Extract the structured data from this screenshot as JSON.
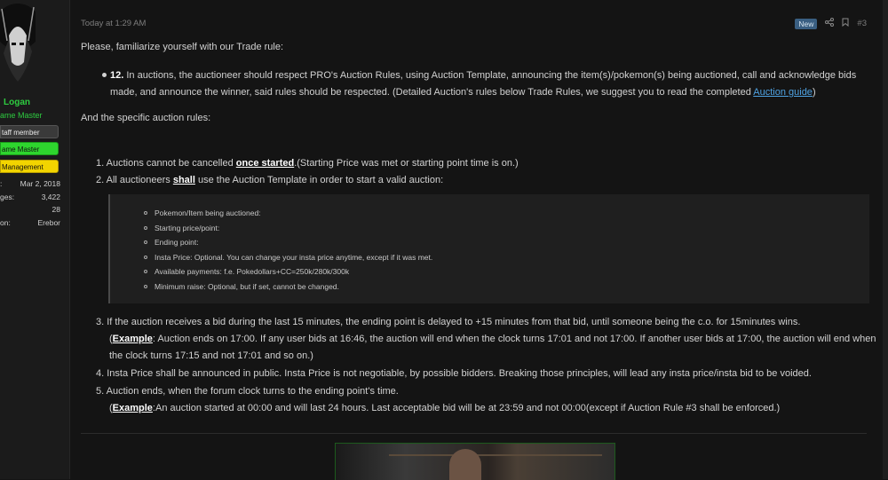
{
  "user": {
    "name": "Logan",
    "title": "ame Master",
    "banners": [
      "taff member",
      "ame Master",
      "Management"
    ],
    "stats": [
      {
        "key": ":",
        "value": "Mar 2, 2018"
      },
      {
        "key": "ges:",
        "value": "3,422"
      },
      {
        "key": "",
        "value": "28"
      },
      {
        "key": "on:",
        "value": "Erebor"
      }
    ]
  },
  "post": {
    "date": "Today at 1:29 AM",
    "badge": "New",
    "number": "#3",
    "intro": "Please, familiarize yourself with our Trade rule:",
    "rule_num": "12.",
    "rule_text": " In auctions, the auctioneer should respect PRO's Auction Rules, using Auction Template, announcing the item(s)/pokemon(s) being auctioned, call and acknowledge bids made, and announce the winner, said rules should be respected. (Detailed Auction's rules below Trade Rules, we suggest you to read the completed ",
    "rule_link": "Auction guide",
    "rule_end": ")",
    "specific": "And the specific auction rules:",
    "r1_a": "1. Auctions cannot be cancelled ",
    "r1_b": "once started",
    "r1_c": ".(Starting Price was met or starting point time is on.)",
    "r2_a": "2. All auctioneers ",
    "r2_b": "shall",
    "r2_c": " use the Auction Template in order to start a valid auction:",
    "template": [
      "Pokemon/Item being auctioned:",
      "Starting price/point:",
      "Ending point:",
      "Insta Price: Optional. You can change your insta price anytime, except if it was met.",
      "Available payments: f.e. Pokedollars+CC=250k/280k/300k",
      "Minimum raise: Optional, but if set, cannot be changed."
    ],
    "r3": "3. If the auction receives a bid during the last 15 minutes, the ending point is delayed to +15 minutes from that bid, until someone being the c.o. for 15minutes wins.",
    "r3_ex_a": "(",
    "r3_ex_b": "Example",
    "r3_ex_c": ": Auction ends on 17:00. If any user bids at 16:46, the auction will end when the clock turns 17:01 and not 17:00. If another user bids at 17:00, the auction will end when the clock turns 17:15 and not 17:01 and so on.)",
    "r4": "4. Insta Price shall be announced in public. Insta Price is not negotiable, by possible bidders. Breaking those principles, will lead any insta price/insta bid to be voided.",
    "r5": "5. Auction ends, when the forum clock turns to the ending point's time.",
    "r5_ex_a": "(",
    "r5_ex_b": "Example",
    "r5_ex_c": ":An auction started at 00:00 and will last 24 hours. Last acceptable bid will be at 23:59 and not 00:00(except if Auction Rule #3 shall be enforced.)"
  },
  "icons": {
    "share": "share-icon",
    "bookmark": "bookmark-icon"
  },
  "colors": {
    "username": "#2ecc40",
    "link": "#4fa3e3",
    "staff_banner": "#3a3a3a",
    "gm_banner": "#2ed52e",
    "mgmt_banner": "#f2d400",
    "new_badge": "#3a5f82"
  }
}
